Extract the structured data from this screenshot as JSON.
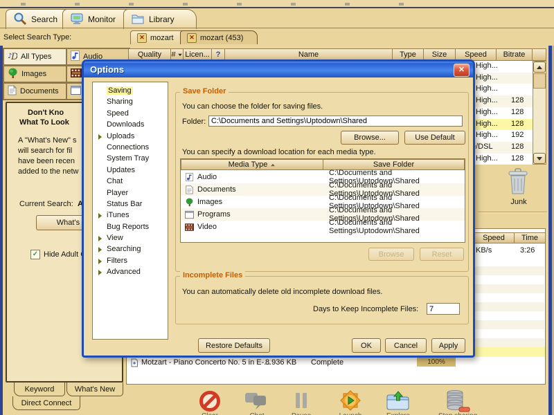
{
  "app": {
    "main_tabs": [
      {
        "label": "Search"
      },
      {
        "label": "Monitor"
      },
      {
        "label": "Library"
      }
    ],
    "select_search_type": "Select Search Type:",
    "search_types": {
      "all_types": "All Types",
      "images": "Images",
      "documents": "Documents",
      "audio": "Audio"
    },
    "session_tabs": [
      {
        "label": "mozart"
      },
      {
        "label": "mozart (453)"
      }
    ],
    "results": {
      "columns": [
        "Quality",
        "#",
        "Licen...",
        "Name",
        "Type",
        "Size",
        "Speed",
        "Bitrate"
      ],
      "help_label": "?",
      "rows": [
        {
          "speed": "High...",
          "bitrate": ""
        },
        {
          "speed": "High...",
          "bitrate": ""
        },
        {
          "speed": "High...",
          "bitrate": ""
        },
        {
          "speed": "High...",
          "bitrate": "128"
        },
        {
          "speed": "High...",
          "bitrate": "128"
        },
        {
          "speed": "High...",
          "bitrate": "128"
        },
        {
          "speed": "High...",
          "bitrate": "192"
        },
        {
          "speed": "e/DSL",
          "bitrate": "128"
        },
        {
          "speed": "High...",
          "bitrate": "128"
        }
      ]
    },
    "info_panel": {
      "title1": "Don't Kno",
      "title2": "What To Look",
      "line1": "A \"What's New\" s",
      "line2": "will search for fil",
      "line3": "have been recen",
      "line4": "added to the netw",
      "current_search_label": "Current Search:",
      "current_search_value": "A",
      "whats_new_button": "What's Ne",
      "hide_adult": "Hide Adult C"
    },
    "junk_label": "Junk",
    "downloads": {
      "columns": [
        "Speed",
        "Time"
      ],
      "row": {
        "speed": "KB/s",
        "time": "3:26"
      },
      "item": {
        "name": "Motzart - Piano Concerto No. 5 in E-...",
        "size": "8.936 KB",
        "status": "Complete",
        "progress": "100%"
      }
    },
    "bottom_tabs": [
      {
        "label": "Keyword"
      },
      {
        "label": "What's New"
      },
      {
        "label": "Direct Connect"
      }
    ],
    "toolbar_labels": [
      {
        "label": "Clear"
      },
      {
        "label": "Chat"
      },
      {
        "label": "Pause"
      },
      {
        "label": "Launch"
      },
      {
        "label": "Explore"
      },
      {
        "label": "Stop sharing"
      }
    ]
  },
  "dialog": {
    "title": "Options",
    "menu": [
      {
        "label": "Saving"
      },
      {
        "label": "Sharing"
      },
      {
        "label": "Speed"
      },
      {
        "label": "Downloads"
      },
      {
        "label": "Uploads"
      },
      {
        "label": "Connections"
      },
      {
        "label": "System Tray"
      },
      {
        "label": "Updates"
      },
      {
        "label": "Chat"
      },
      {
        "label": "Player"
      },
      {
        "label": "Status Bar"
      },
      {
        "label": "iTunes"
      },
      {
        "label": "Bug Reports"
      },
      {
        "label": "View"
      },
      {
        "label": "Searching"
      },
      {
        "label": "Filters"
      },
      {
        "label": "Advanced"
      }
    ],
    "save_folder": {
      "title": "Save Folder",
      "desc": "You can choose the folder for saving files.",
      "folder_label": "Folder:",
      "folder_value": "C:\\Documents and Settings\\Uptodown\\Shared",
      "browse": "Browse...",
      "use_default": "Use Default",
      "media_desc": "You can specify a download location for each media type.",
      "table": {
        "col_type": "Media Type",
        "col_folder": "Save Folder",
        "rows": [
          {
            "type": "Audio",
            "folder": "C:\\Documents and Settings\\Uptodown\\Shared"
          },
          {
            "type": "Documents",
            "folder": "C:\\Documents and Settings\\Uptodown\\Shared"
          },
          {
            "type": "Images",
            "folder": "C:\\Documents and Settings\\Uptodown\\Shared"
          },
          {
            "type": "Programs",
            "folder": "C:\\Documents and Settings\\Uptodown\\Shared"
          },
          {
            "type": "Video",
            "folder": "C:\\Documents and Settings\\Uptodown\\Shared"
          }
        ]
      },
      "browse2": "Browse",
      "reset": "Reset"
    },
    "incomplete": {
      "title": "Incomplete Files",
      "desc": "You can automatically delete old incomplete download files.",
      "days_label": "Days to Keep Incomplete Files:",
      "days_value": "7"
    },
    "buttons": {
      "restore": "Restore Defaults",
      "ok": "OK",
      "cancel": "Cancel",
      "apply": "Apply"
    }
  }
}
